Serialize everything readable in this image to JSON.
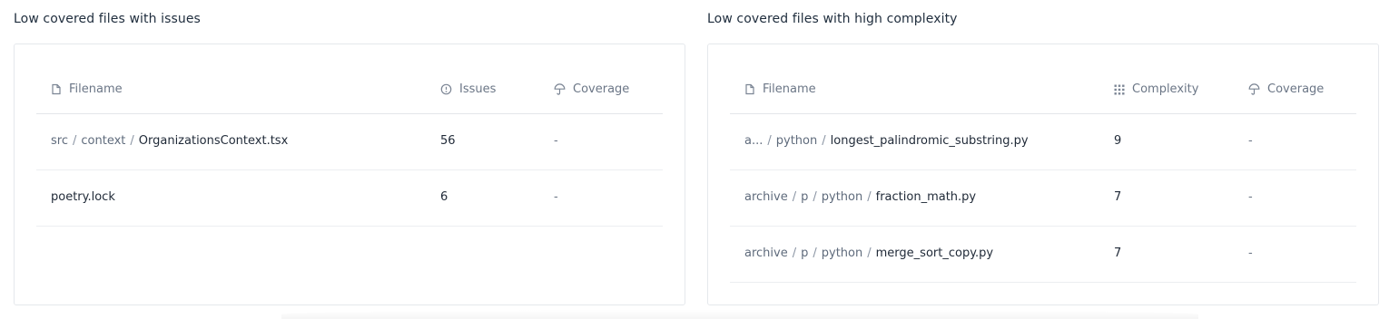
{
  "left_panel": {
    "title": "Low covered files with issues",
    "columns": {
      "filename": "Filename",
      "metric": "Issues",
      "coverage": "Coverage"
    },
    "rows": [
      {
        "segments": [
          "src",
          "context"
        ],
        "file": "OrganizationsContext.tsx",
        "metric": "56",
        "coverage": "-"
      },
      {
        "segments": [],
        "file": "poetry.lock",
        "metric": "6",
        "coverage": "-"
      }
    ]
  },
  "right_panel": {
    "title": "Low covered files with high complexity",
    "columns": {
      "filename": "Filename",
      "metric": "Complexity",
      "coverage": "Coverage"
    },
    "rows": [
      {
        "segments": [
          "a...",
          "python"
        ],
        "file": "longest_palindromic_substring.py",
        "metric": "9",
        "coverage": "-"
      },
      {
        "segments": [
          "archive",
          "p",
          "python"
        ],
        "file": "fraction_math.py",
        "metric": "7",
        "coverage": "-"
      },
      {
        "segments": [
          "archive",
          "p",
          "python"
        ],
        "file": "merge_sort_copy.py",
        "metric": "7",
        "coverage": "-"
      }
    ]
  },
  "separator": "/",
  "icons": {
    "filename": "file-icon",
    "issues": "alert-circle-icon",
    "complexity": "grid-dots-icon",
    "coverage": "umbrella-icon"
  }
}
